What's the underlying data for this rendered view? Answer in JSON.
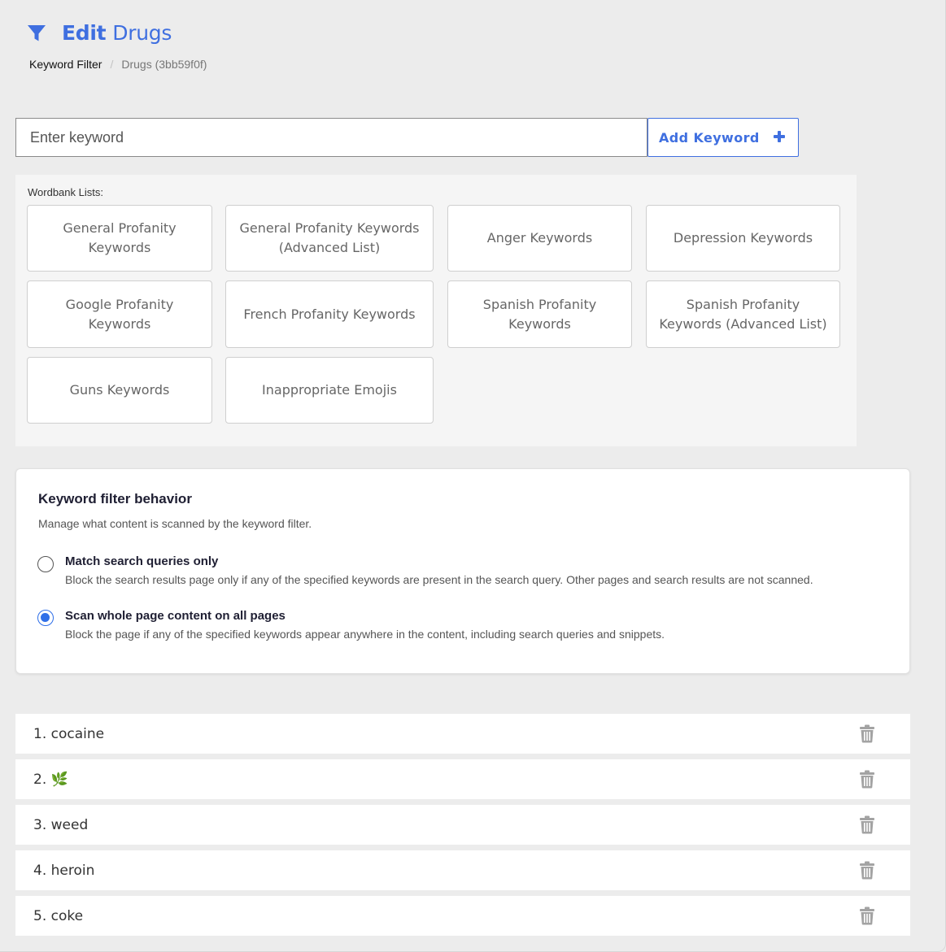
{
  "header": {
    "title_edit": "Edit",
    "title_name": "Drugs",
    "breadcrumb": [
      "Keyword Filter",
      "Drugs (3bb59f0f)"
    ],
    "breadcrumb_separator": "/"
  },
  "keyword_entry": {
    "placeholder": "Enter keyword",
    "value": "",
    "add_label": "Add Keyword"
  },
  "wordbank": {
    "label": "Wordbank Lists:",
    "items": [
      "General Profanity Keywords",
      "General Profanity Keywords (Advanced List)",
      "Anger Keywords",
      "Depression Keywords",
      "Google Profanity Keywords",
      "French Profanity Keywords",
      "Spanish Profanity Keywords",
      "Spanish Profanity Keywords (Advanced List)",
      "Guns Keywords",
      "Inappropriate Emojis"
    ]
  },
  "behavior": {
    "title": "Keyword filter behavior",
    "description": "Manage what content is scanned by the keyword filter.",
    "options": [
      {
        "title": "Match search queries only",
        "description": "Block the search results page only if any of the specified keywords are present in the search query. Other pages and search results are not scanned.",
        "selected": false
      },
      {
        "title": "Scan whole page content on all pages",
        "description": "Block the page if any of the specified keywords appear anywhere in the content, including search queries and snippets.",
        "selected": true
      }
    ]
  },
  "keywords": [
    "1. cocaine",
    "2. 🌿",
    "3. weed",
    "4. heroin",
    "5. coke"
  ],
  "colors": {
    "accent": "#3f6fe0",
    "radio_selected": "#2f6fe8",
    "page_background": "#ececec",
    "trash_icon": "#a3a3a3"
  },
  "icons": {
    "header": "filter-icon",
    "add": "plus-icon",
    "row_action": "trash-icon"
  }
}
